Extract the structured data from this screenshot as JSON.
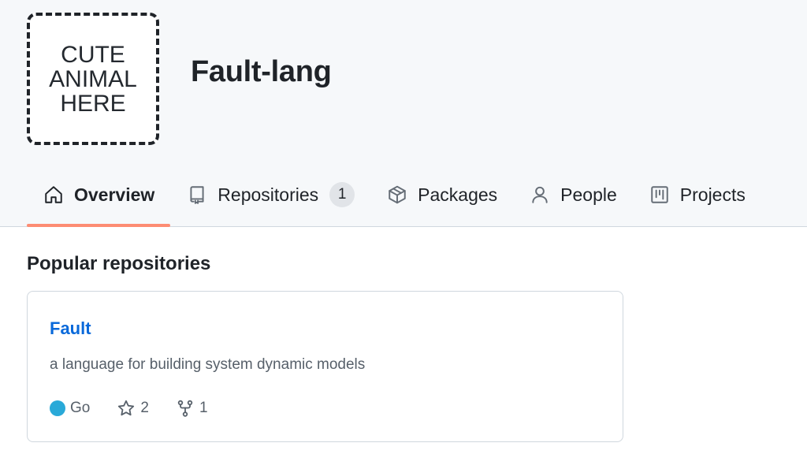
{
  "org": {
    "avatar_text": "CUTE\nANIMAL\nHERE",
    "name": "Fault-lang"
  },
  "tabs": [
    {
      "label": "Overview",
      "icon": "home-icon",
      "selected": true
    },
    {
      "label": "Repositories",
      "icon": "repo-icon",
      "count": "1"
    },
    {
      "label": "Packages",
      "icon": "package-icon"
    },
    {
      "label": "People",
      "icon": "person-icon"
    },
    {
      "label": "Projects",
      "icon": "project-icon"
    }
  ],
  "popular": {
    "title": "Popular repositories",
    "repos": [
      {
        "name": "Fault",
        "description": "a language for building system dynamic models",
        "language": "Go",
        "language_color": "#29a9d8",
        "stars": "2",
        "forks": "1"
      }
    ]
  },
  "colors": {
    "accent_underline": "#fd8c73",
    "link": "#0969da"
  }
}
